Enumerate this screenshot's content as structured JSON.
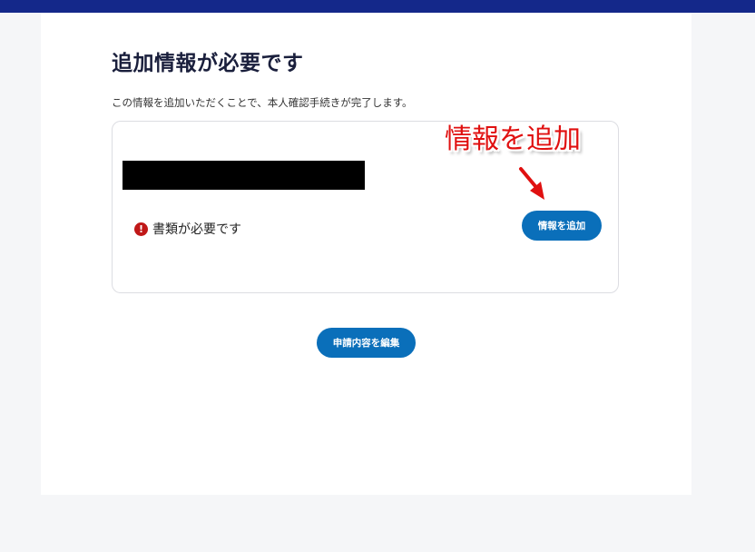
{
  "page": {
    "title": "追加情報が必要です",
    "description": "この情報を追加いただくことで、本人確認手続きが完了します。"
  },
  "card": {
    "status_text": "書類が必要です",
    "status_icon": "exclamation-circle-icon",
    "add_button_label": "情報を追加"
  },
  "actions": {
    "edit_button_label": "申請内容を編集"
  },
  "annotation": {
    "text": "情報を追加"
  },
  "colors": {
    "header": "#14288a",
    "button": "#0a6fba",
    "alert": "#c01818",
    "annotation": "#e01010"
  }
}
